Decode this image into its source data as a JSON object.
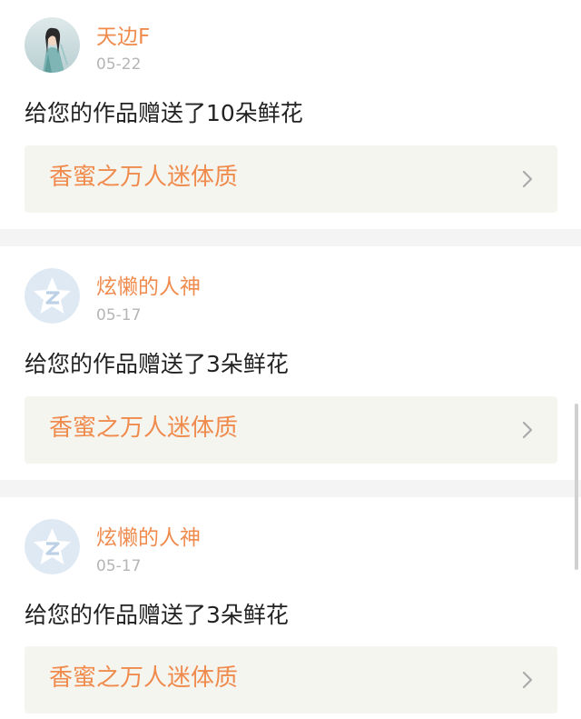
{
  "feed": [
    {
      "user": "天边F",
      "date": "05-22",
      "avatar": "character-portrait",
      "message": "给您的作品赠送了10朵鲜花",
      "work_title": "香蜜之万人迷体质"
    },
    {
      "user": "炫懒的人神",
      "date": "05-17",
      "avatar": "default-z-avatar",
      "message": "给您的作品赠送了3朵鲜花",
      "work_title": "香蜜之万人迷体质"
    },
    {
      "user": "炫懒的人神",
      "date": "05-17",
      "avatar": "default-z-avatar",
      "message": "给您的作品赠送了3朵鲜花",
      "work_title": "香蜜之万人迷体质"
    }
  ],
  "colors": {
    "accent": "#f08b4e",
    "tab_indicator": "#e06a9a",
    "card_link_bg": "#f5f5f0",
    "separator": "#f4f4f4"
  }
}
